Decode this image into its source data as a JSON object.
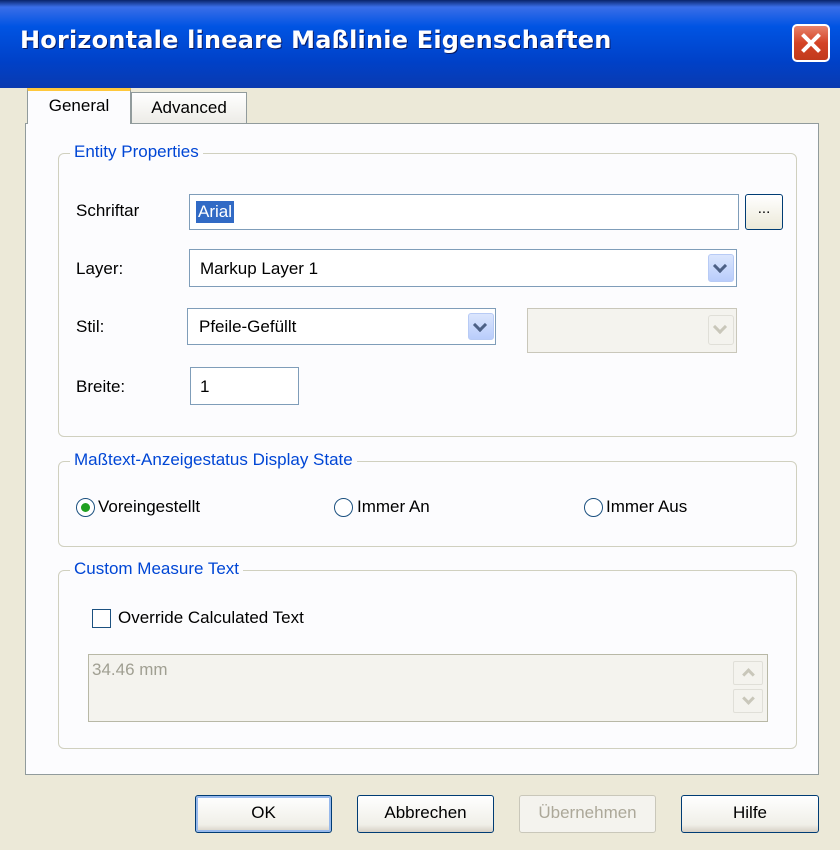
{
  "window": {
    "title": "Horizontale lineare Maßlinie Eigenschaften"
  },
  "tabs": [
    {
      "label": "General",
      "active": true
    },
    {
      "label": "Advanced",
      "active": false
    }
  ],
  "entity_properties": {
    "legend": "Entity Properties",
    "font_label": "Schriftar",
    "font_value": "Arial",
    "font_button": "...",
    "layer_label": "Layer:",
    "layer_value": "Markup Layer 1",
    "style_label": "Stil:",
    "style_value": "Pfeile-Gefüllt",
    "style_secondary_value": "",
    "width_label": "Breite:",
    "width_value": "1"
  },
  "display_state": {
    "legend": "Maßtext-Anzeigestatus Display State",
    "options": [
      {
        "label": "Voreingestellt",
        "checked": true
      },
      {
        "label": "Immer An",
        "checked": false
      },
      {
        "label": "Immer Aus",
        "checked": false
      }
    ]
  },
  "custom_text": {
    "legend": "Custom Measure Text",
    "override_label": "Override Calculated Text",
    "override_checked": false,
    "text_value": "34.46 mm"
  },
  "buttons": {
    "ok": "OK",
    "cancel": "Abbrechen",
    "apply": "Übernehmen",
    "help": "Hilfe"
  },
  "colors": {
    "titlebar": "#0054e3",
    "legend_text": "#0046d5",
    "radio_dot": "#21a121",
    "close_button": "#d44325"
  }
}
